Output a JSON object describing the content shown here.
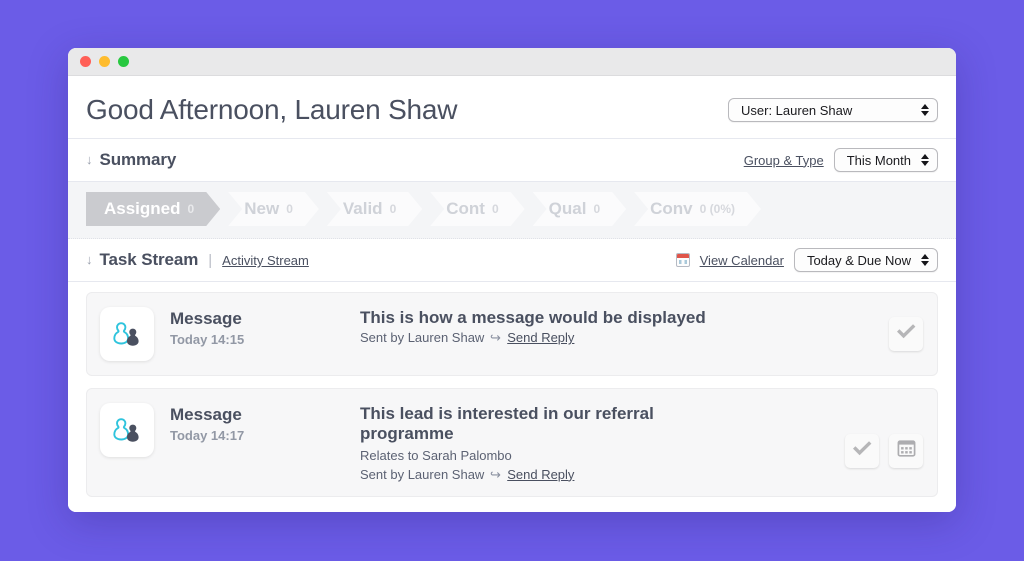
{
  "window": {
    "traffic_lights": [
      "close",
      "minimize",
      "zoom"
    ],
    "background_color": "#6b5ce7"
  },
  "header": {
    "greeting": "Good Afternoon, Lauren Shaw",
    "user_select": {
      "value": "User: Lauren Shaw",
      "options": [
        "User: Lauren Shaw"
      ]
    }
  },
  "summary": {
    "caret": "↓",
    "title": "Summary",
    "group_type_link": "Group & Type",
    "period_select": {
      "value": "This Month",
      "options": [
        "This Month"
      ]
    },
    "funnel": [
      {
        "label": "Assigned",
        "count": "0",
        "active": true
      },
      {
        "label": "New",
        "count": "0",
        "active": false
      },
      {
        "label": "Valid",
        "count": "0",
        "active": false
      },
      {
        "label": "Cont",
        "count": "0",
        "active": false
      },
      {
        "label": "Qual",
        "count": "0",
        "active": false
      },
      {
        "label": "Conv",
        "count": "0 (0%)",
        "active": false
      }
    ]
  },
  "task_stream": {
    "caret": "↓",
    "title": "Task Stream",
    "separator": "|",
    "activity_link": "Activity Stream",
    "calendar_icon": "calendar-icon",
    "view_calendar_link": "View Calendar",
    "filter_select": {
      "value": "Today & Due Now",
      "options": [
        "Today & Due Now"
      ]
    },
    "cards": [
      {
        "avatar_icon": "contacts-avatar-icon",
        "type": "Message",
        "time": "Today 14:15",
        "title": "This is how a message would be displayed",
        "relates_to": "",
        "sent_by": "Sent by Lauren Shaw",
        "reply_arrow": "↩",
        "reply_link": "Send Reply",
        "actions": [
          "complete-check-icon"
        ]
      },
      {
        "avatar_icon": "contacts-avatar-icon",
        "type": "Message",
        "time": "Today 14:17",
        "title": "This lead is interested in our referral programme",
        "relates_to": "Relates to Sarah Palombo",
        "sent_by": "Sent by Lauren Shaw",
        "reply_arrow": "↩",
        "reply_link": "Send Reply",
        "actions": [
          "complete-check-icon",
          "calendar-grid-icon"
        ]
      }
    ]
  }
}
